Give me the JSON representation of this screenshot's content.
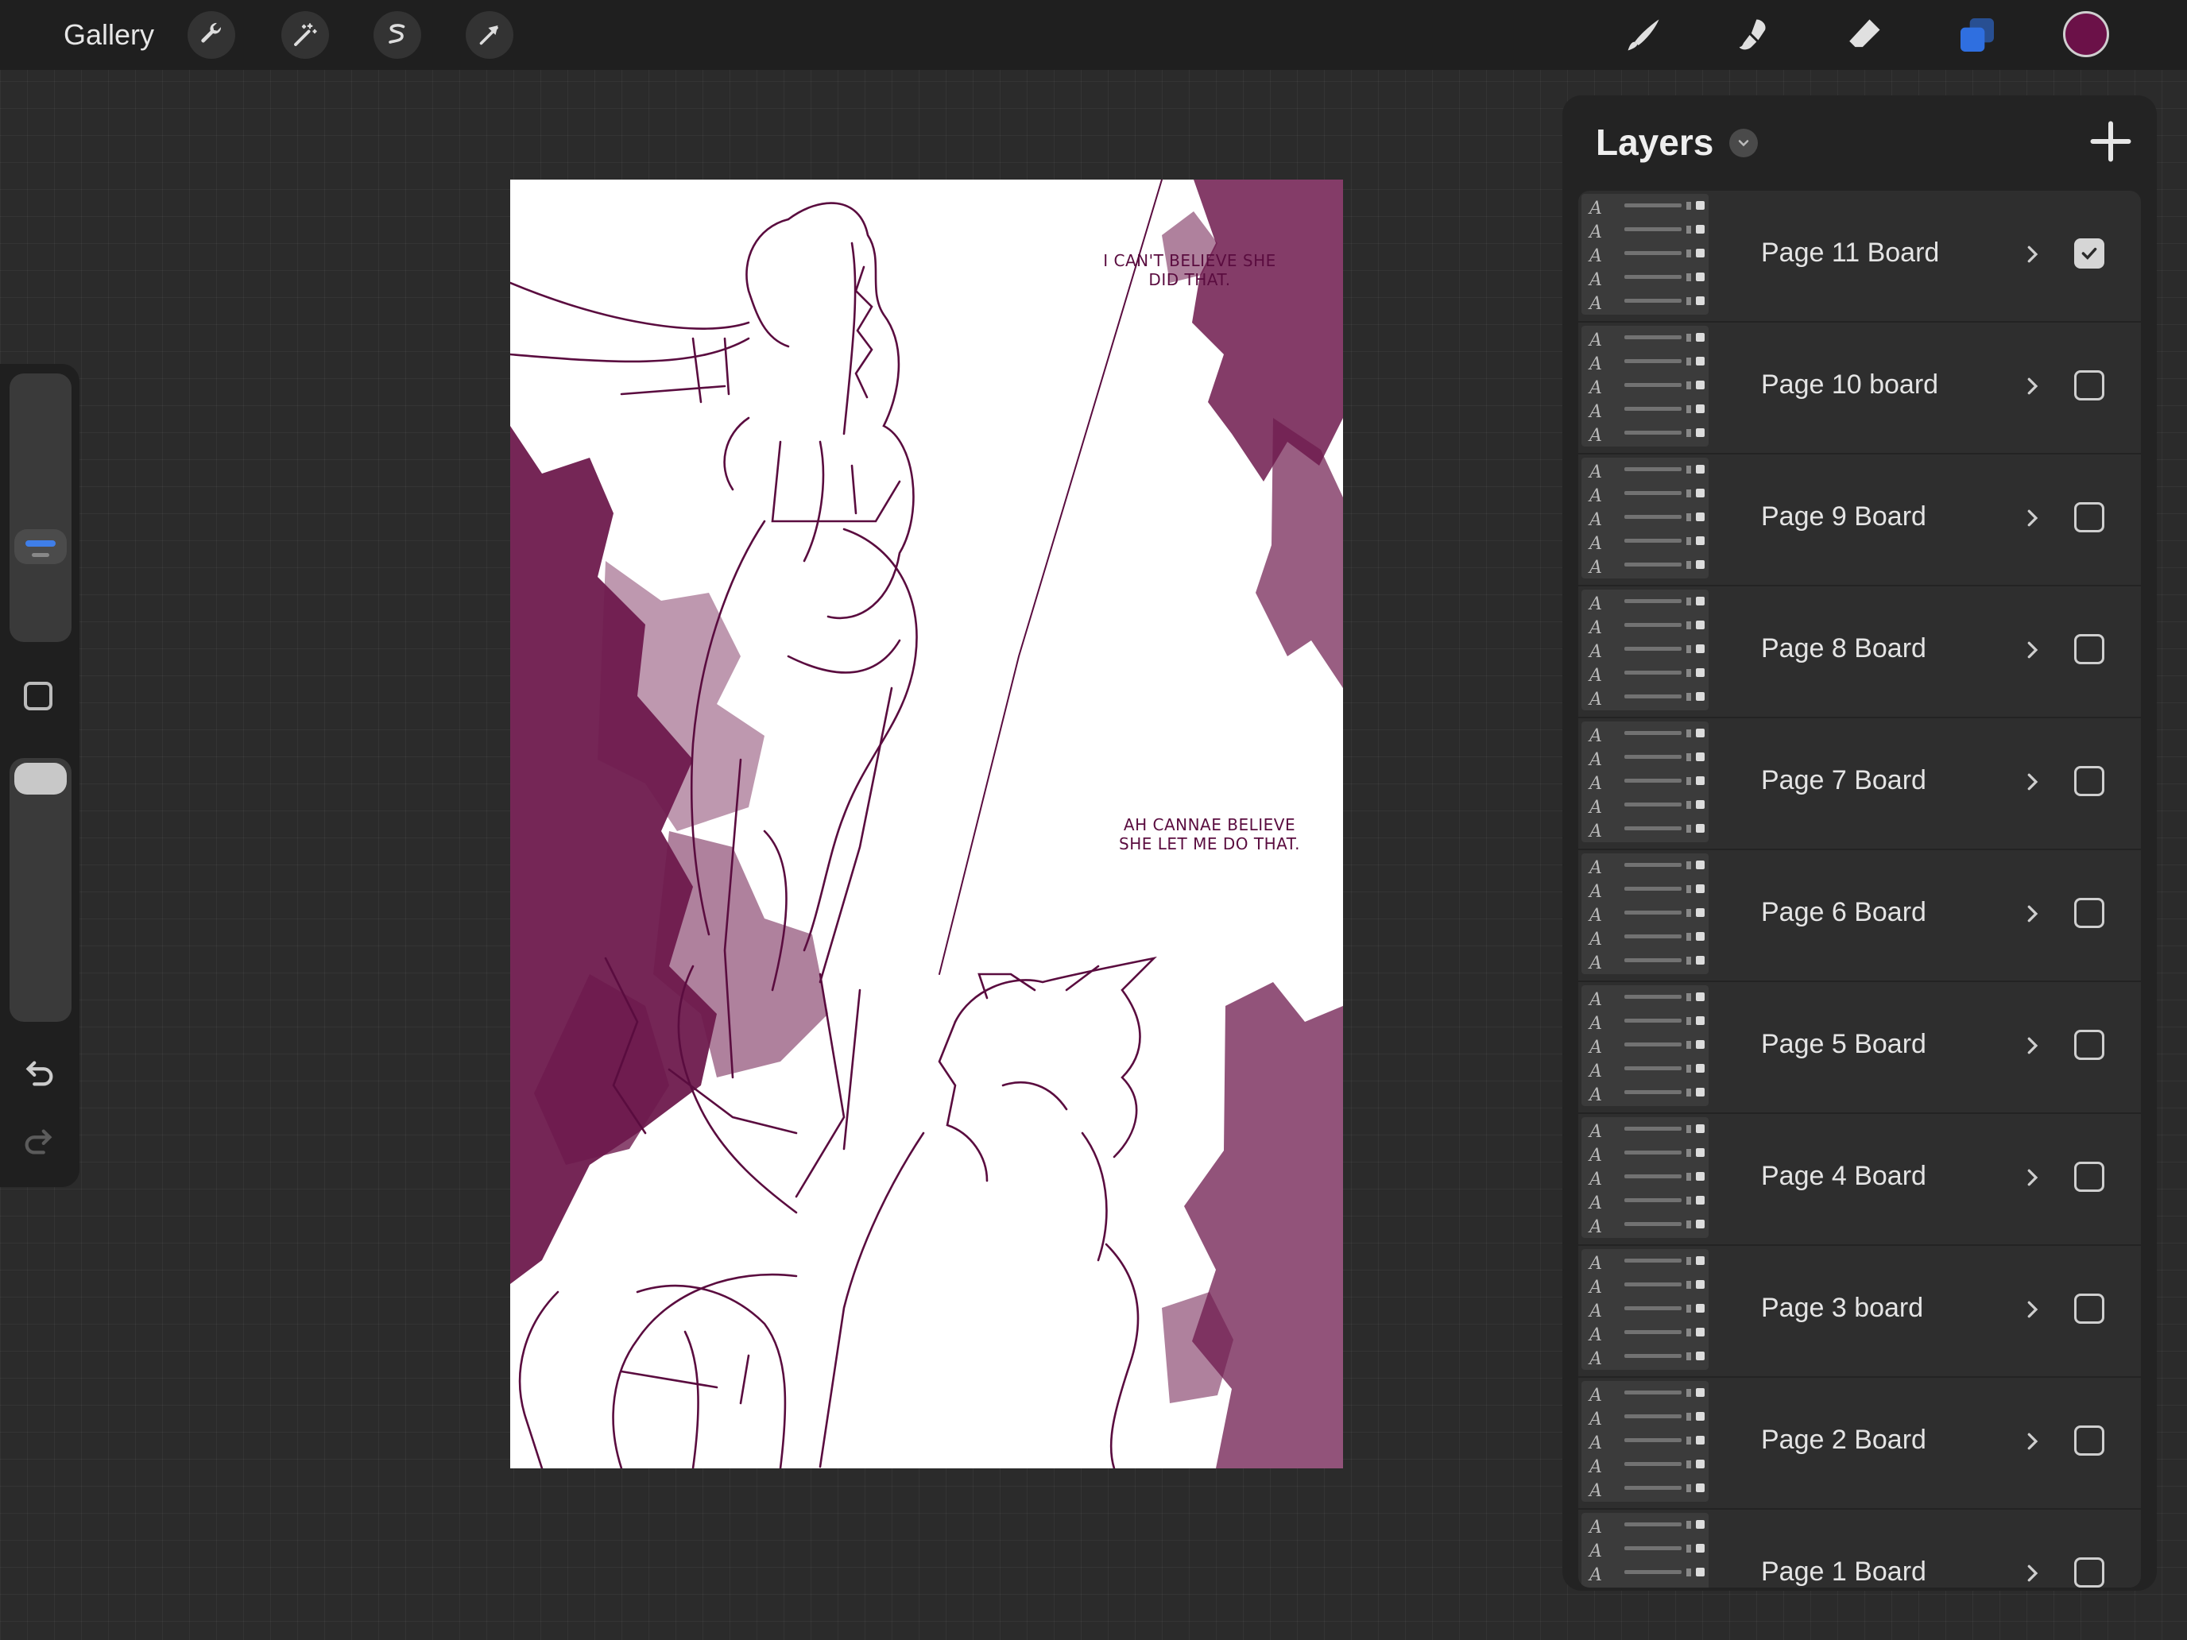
{
  "toolbar": {
    "gallery_label": "Gallery",
    "left_tools": [
      "wrench-icon",
      "magic-wand-icon",
      "selection-icon",
      "transform-arrow-icon"
    ],
    "right_tools": [
      "brush-icon",
      "smudge-icon",
      "eraser-icon",
      "layers-icon"
    ],
    "current_color": "#6b1148",
    "active_tool_color": "#2f6fe0"
  },
  "sidebar": {
    "brush_size_slider": "brush-size",
    "opacity_slider": "opacity",
    "modify_button": "modify-square-icon",
    "undo": "undo-icon",
    "redo": "redo-icon"
  },
  "canvas": {
    "captions": [
      "I CAN'T BELIEVE SHE DID THAT.",
      "AH CANNAE BELIEVE SHE LET ME DO THAT."
    ],
    "ink_color": "#5a0c3f",
    "foliage_color": "#6e1a4d"
  },
  "layers_panel": {
    "title": "Layers",
    "layers": [
      {
        "name": "Page 11 Board",
        "visible": true
      },
      {
        "name": "Page 10 board",
        "visible": false
      },
      {
        "name": "Page 9 Board",
        "visible": false
      },
      {
        "name": "Page 8 Board",
        "visible": false
      },
      {
        "name": "Page 7 Board",
        "visible": false
      },
      {
        "name": "Page 6 Board",
        "visible": false
      },
      {
        "name": "Page 5 Board",
        "visible": false
      },
      {
        "name": "Page 4 Board",
        "visible": false
      },
      {
        "name": "Page 3 board",
        "visible": false
      },
      {
        "name": "Page 2 Board",
        "visible": false
      },
      {
        "name": "Page 1 Board",
        "visible": false
      }
    ]
  }
}
